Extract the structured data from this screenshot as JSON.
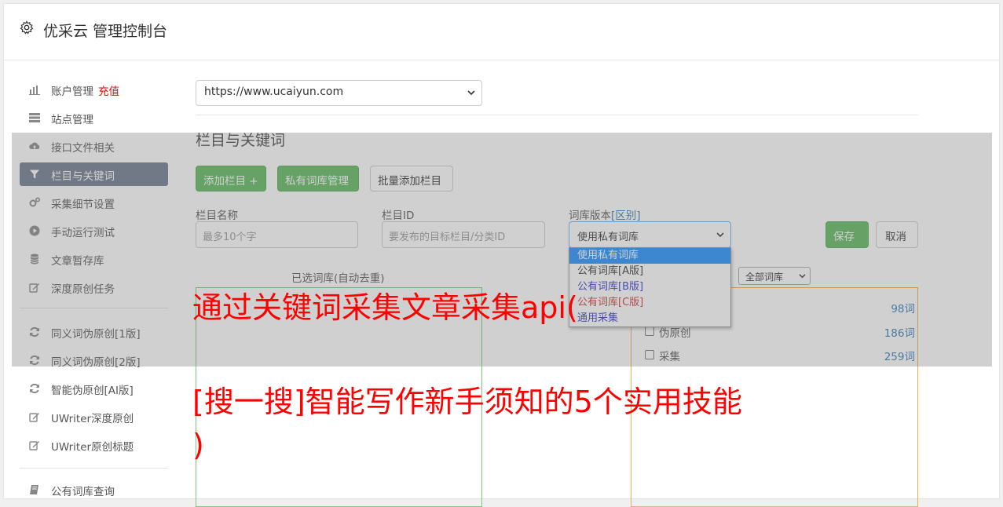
{
  "header": {
    "title": "优采云 管理控制台"
  },
  "sidebar": {
    "items": [
      {
        "label": "账户管理",
        "extra": "充值"
      },
      {
        "label": "站点管理"
      },
      {
        "label": "接口文件相关"
      },
      {
        "label": "栏目与关键词"
      },
      {
        "label": "采集细节设置"
      },
      {
        "label": "手动运行测试"
      },
      {
        "label": "文章暂存库"
      },
      {
        "label": "深度原创任务"
      },
      {
        "label": "同义词伪原创[1版]"
      },
      {
        "label": "同义词伪原创[2版]"
      },
      {
        "label": "智能伪原创[AI版]"
      },
      {
        "label": "UWriter深度原创"
      },
      {
        "label": "UWriter原创标题"
      },
      {
        "label": "公有词库查询"
      }
    ]
  },
  "main": {
    "site_select": "https://www.ucaiyun.com",
    "section_title": "栏目与关键词",
    "buttons": {
      "add_column": "添加栏目 +",
      "private_lib": "私有词库管理",
      "batch_add": "批量添加栏目"
    },
    "form": {
      "name_label": "栏目名称",
      "name_placeholder": "最多10个字",
      "id_label": "栏目ID",
      "id_placeholder": "要发布的目标栏目/分类ID",
      "version_label": "词库版本",
      "version_link": "[区别]",
      "version_value": "使用私有词库",
      "save": "保存",
      "cancel": "取消"
    },
    "dropdown_options": [
      "使用私有词库",
      "公有词库[A版]",
      "公有词库[B版]",
      "公有词库[C版]",
      "通用采集"
    ],
    "selected_panel_head": "已选词库(自动去重)",
    "filter_select": "全部词库",
    "libraries": [
      {
        "name": "",
        "count": "98词"
      },
      {
        "name": "伪原创",
        "count": "186词"
      },
      {
        "name": "采集",
        "count": "259词"
      }
    ]
  },
  "overlay_text": {
    "line1": "通过关键词采集文章采集api(",
    "line2": "[搜一搜]智能写作新手须知的5个实用技能",
    "line3": ")"
  }
}
